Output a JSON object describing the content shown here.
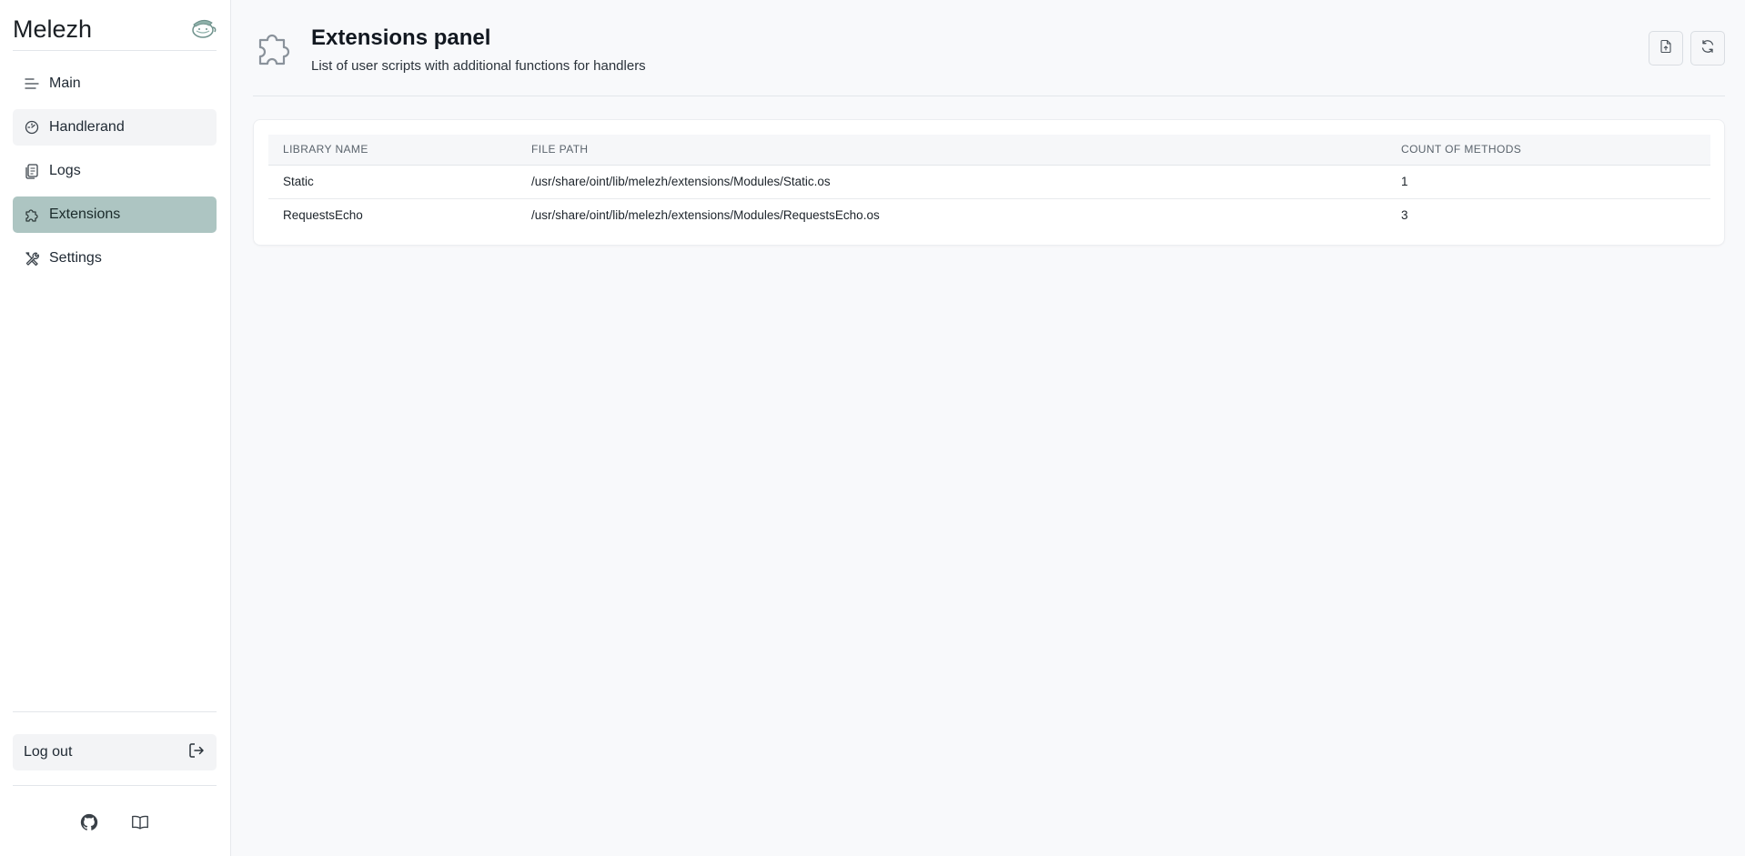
{
  "app": {
    "title": "Melezh"
  },
  "sidebar": {
    "items": [
      {
        "label": "Main",
        "icon": "menu-lines-icon",
        "state": "default"
      },
      {
        "label": "Handlerand",
        "icon": "dashboard-gauge-icon",
        "state": "hover"
      },
      {
        "label": "Logs",
        "icon": "logs-documents-icon",
        "state": "default"
      },
      {
        "label": "Extensions",
        "icon": "puzzle-icon",
        "state": "active"
      },
      {
        "label": "Settings",
        "icon": "tools-icon",
        "state": "default"
      }
    ],
    "logout_label": "Log out",
    "footer_icons": [
      "github-icon",
      "book-icon"
    ]
  },
  "header": {
    "title": "Extensions panel",
    "subtitle": "List of user scripts with additional functions for handlers",
    "actions": [
      "upload-file-icon",
      "refresh-icon"
    ]
  },
  "table": {
    "columns": [
      "LIBRARY NAME",
      "FILE PATH",
      "COUNT OF METHODS"
    ],
    "rows": [
      {
        "name": "Static",
        "path": "/usr/share/oint/lib/melezh/extensions/Modules/Static.os",
        "count": "1"
      },
      {
        "name": "RequestsEcho",
        "path": "/usr/share/oint/lib/melezh/extensions/Modules/RequestsEcho.os",
        "count": "3"
      }
    ]
  },
  "colors": {
    "active_nav": "#adc5c2",
    "background": "#f8f9fb",
    "brand_logo": "#7fa49d"
  }
}
